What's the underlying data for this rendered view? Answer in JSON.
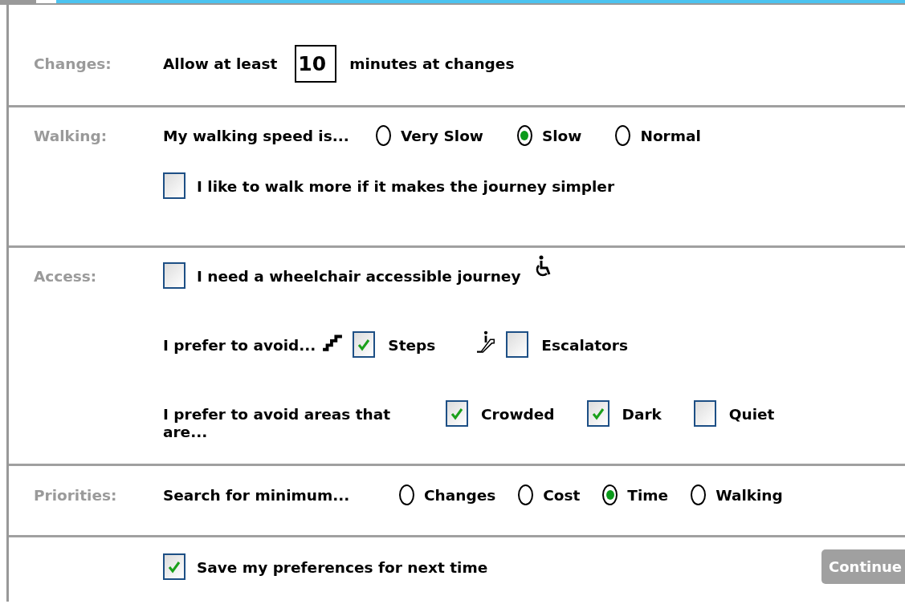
{
  "sections": [
    {
      "label": "Changes:",
      "rows": [
        {
          "kind": "minutes",
          "before": "Allow at least",
          "value": "10",
          "after": "minutes at changes"
        }
      ]
    },
    {
      "label": "Walking:",
      "rows": [
        {
          "kind": "radios",
          "prompt": "My walking speed is...",
          "options": [
            {
              "label": "Very Slow",
              "selected": false
            },
            {
              "label": "Slow",
              "selected": true
            },
            {
              "label": "Normal",
              "selected": false
            }
          ]
        },
        {
          "kind": "checkbox",
          "label": "I like to walk more if it makes the journey simpler",
          "checked": false
        }
      ]
    },
    {
      "label": "Access:",
      "rows": [
        {
          "kind": "checkbox",
          "label": "I need a wheelchair accessible journey",
          "checked": false
        },
        {
          "kind": "checks",
          "prompt": "I prefer to avoid...",
          "options": [
            {
              "label": "Steps",
              "checked": true
            },
            {
              "label": "Escalators",
              "checked": false
            }
          ]
        },
        {
          "kind": "checks",
          "prompt": "I prefer to avoid areas that are...",
          "options": [
            {
              "label": "Crowded",
              "checked": true
            },
            {
              "label": "Dark",
              "checked": true
            },
            {
              "label": "Quiet",
              "checked": false
            }
          ]
        }
      ]
    },
    {
      "label": "Priorities:",
      "rows": [
        {
          "kind": "radios",
          "prompt": "Search for minimum...",
          "options": [
            {
              "label": "Changes",
              "selected": false
            },
            {
              "label": "Cost",
              "selected": false
            },
            {
              "label": "Time",
              "selected": true
            },
            {
              "label": "Walking",
              "selected": false
            }
          ]
        }
      ]
    },
    {
      "rows": [
        {
          "kind": "checkbox",
          "label": "Save my preferences for next time",
          "checked": true
        }
      ],
      "button": "Continue"
    }
  ]
}
